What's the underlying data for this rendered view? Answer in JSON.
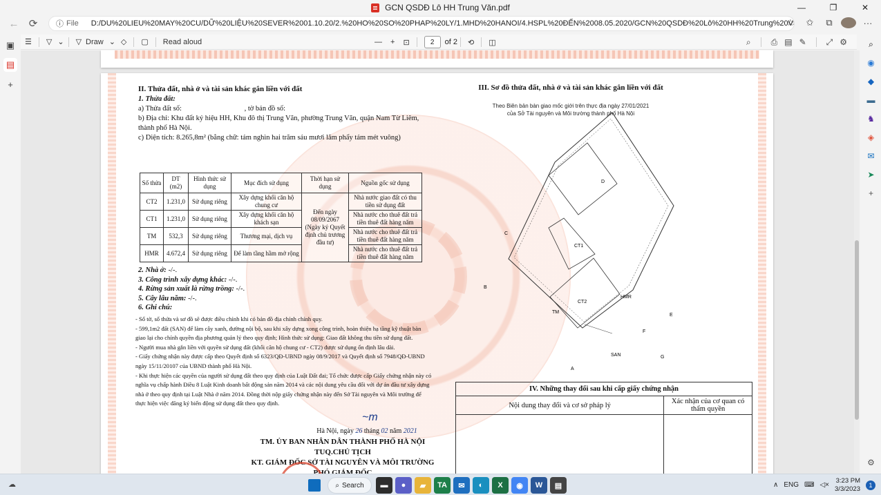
{
  "window": {
    "title": "GCN QSDĐ Lô HH Trung Văn.pdf",
    "minimize": "—",
    "maximize": "❐",
    "close": "✕"
  },
  "addressbar": {
    "back": "←",
    "refresh": "⟳",
    "info_icon": "ⓘ",
    "file_label": "File",
    "url": "D:/DU%20LIEU%20MAY%20CU/DỮ%20LIỆU%20SEVER%2001.10.20/2.%20HO%20SO%20PHAP%20LY/1.MHD%20HANOI/4.HSPL%20ĐẾN%2008.05.2020/GCN%20QSDĐ%20Lô%20HH%20Trung%20Văn.pdf",
    "star": "☆",
    "favorites": "✩",
    "collections": "⧉",
    "more": "···"
  },
  "toolbar": {
    "toc": "☰",
    "highlight": "▽",
    "highlight_caret": "⌄",
    "draw_icon": "▽",
    "draw_label": "Draw",
    "draw_caret": "⌄",
    "erase": "◇",
    "text_box": "▢",
    "read_aloud": "Read aloud",
    "zoom_out": "—",
    "zoom_in": "+",
    "fit": "⊡",
    "page_current": "2",
    "page_total": "of 2",
    "rotate": "⟲",
    "two_page": "◫",
    "search": "⌕",
    "print": "⎙",
    "save": "▤",
    "save_as": "✎",
    "fullscreen": "⤢",
    "settings": "⚙"
  },
  "document": {
    "sec2_title": "II. Thửa đất, nhà ở và tài sản khác gắn liền với đất",
    "land_heading": "1. Thửa đất:",
    "land_a": "a) Thửa đất số:",
    "land_a_map": ", tờ bản đồ số:",
    "land_b": "b) Địa chỉ: Khu đất ký hiệu HH, Khu đô thị Trung Văn, phường Trung Văn, quận Nam Từ Liêm, thành phố Hà Nội.",
    "land_c": "c) Diện tích: 8.265,8m² (bằng chữ: tám nghìn hai trăm sáu mươi lăm phẩy tám mét vuông)",
    "table_headers": [
      "Số thửa",
      "DT (m2)",
      "Hình thức sử dụng",
      "Mục đích sử dụng",
      "Thời hạn sử dụng",
      "Nguồn gốc sử dụng"
    ],
    "table_rows": [
      {
        "so": "CT2",
        "dt": "1.231,0",
        "hinh": "Sử dụng riêng",
        "muc": "Xây dựng khối căn hộ chung cư",
        "nguon": "Nhà nước giao đất có thu tiền sử dụng đất"
      },
      {
        "so": "CT1",
        "dt": "1.231,0",
        "hinh": "Sử dụng riêng",
        "muc": "Xây dựng khối căn hộ khách sạn",
        "nguon": "Nhà nước cho thuê đất trả tiền thuê đất hàng năm"
      },
      {
        "so": "TM",
        "dt": "532,3",
        "hinh": "Sử dụng riêng",
        "muc": "Thương mại, dịch vụ",
        "nguon": "Nhà nước cho thuê đất trả tiền thuê đất hàng năm"
      },
      {
        "so": "HMR",
        "dt": "4.672,4",
        "hinh": "Sử dụng riêng",
        "muc": "Để làm tầng hầm mở rộng",
        "nguon": "Nhà nước cho thuê đất trả tiền thuê đất hàng năm"
      }
    ],
    "thoi_han": "Đến ngày 08/09/2067 (Ngày ký Quyết định chủ trương đầu tư)",
    "item2": "2. Nhà ở:",
    "item2_val": "-/-.",
    "item3": "3. Công trình xây dựng khác:",
    "item3_val": "-/-.",
    "item4": "4. Rừng sản xuất là rừng trồng:",
    "item4_val": "-/-.",
    "item5": "5. Cây lâu năm:",
    "item5_val": "-/-.",
    "item6": "6. Ghi chú:",
    "notes": [
      "- Số tờ, số thửa và sơ đồ sẽ được điều chỉnh khi có bản đồ địa chính chính quy.",
      "- 599,1m2 đất (SAN) để làm cây xanh, đường nội bộ, sau khi xây dựng xong công trình, hoàn thiện hạ tầng kỹ thuật bàn giao lại cho chính quyền địa phương quản lý theo quy định; Hình thức sử dụng: Giao đất không thu tiền sử dụng đất.",
      "- Người mua nhà gắn liền với quyền sử dụng đất (khối căn hộ chung cư - CT2) được sử dụng ổn định lâu dài.",
      "- Giấy chứng nhận này được cấp theo Quyết định số 6323/QĐ-UBND ngày 08/9/2017 và Quyết định số 7948/QĐ-UBND ngày 15/11/20107 của UBND thành phố Hà Nội.",
      "- Khi thực hiện các quyền của người sử dụng đất theo quy định của Luật Đất đai; Tổ chức được cấp Giấy chứng nhận này có nghĩa vụ chấp hành Điều 8 Luật Kinh doanh bất động sản năm 2014 và các nội dung yêu cầu đối với dự án đầu tư xây dựng nhà ở theo quy định tại Luật Nhà ở năm 2014. Đồng thời nộp giấy chứng nhận này đến Sở Tài nguyên và Môi trường để thực hiện việc đăng ký biến động sử dụng đất theo quy định."
    ],
    "date_prefix": "Hà Nội, ngày",
    "date_day": "26",
    "date_month_lbl": "tháng",
    "date_month": "02",
    "date_year_lbl": "năm",
    "date_year": "2021",
    "sign_line1": "TM. ỦY BAN NHÂN DÂN THÀNH PHỐ HÀ NỘI",
    "sign_line2": "TUQ.CHỦ TỊCH",
    "sign_line3": "KT. GIÁM ĐỐC SỞ TÀI NGUYÊN VÀ MÔI TRƯỜNG",
    "sign_line4": "PHÓ GIÁM ĐỐC",
    "sec3_title": "III. Sơ đồ thửa đất, nhà ở và tài sản khác gắn liền với đất",
    "sec3_sub1": "Theo Biên bản bàn giao mốc giới trên thực địa ngày 27/01/2021",
    "sec3_sub2": "của Sở Tài nguyên và Môi trường thành phố Hà Nội",
    "map_labels": {
      "north": "B",
      "a": "A",
      "b": "B",
      "c": "C",
      "d": "D",
      "e": "E",
      "f": "F",
      "g": "G",
      "ct1": "CT1",
      "ct2": "CT2",
      "tm": "TM",
      "hmr": "HMR",
      "san": "SAN"
    },
    "sec4_title": "IV. Những thay đổi sau khi cấp giấy chứng nhận",
    "sec4_col1": "Nội dung thay đổi và cơ sở pháp lý",
    "sec4_col2": "Xác nhận của cơ quan có thẩm quyền"
  },
  "leftbar": {
    "tabs": "▣",
    "pdf_tab": "▤",
    "new_tab": "+"
  },
  "rightbar": {
    "search": "⌕",
    "copilot": "◉",
    "tag": "◆",
    "briefcase": "▬",
    "games": "♞",
    "office": "◈",
    "outlook": "✉",
    "send": "➤",
    "add": "+",
    "settings": "⚙",
    "colors": {
      "search": "#555555",
      "copilot": "#2b7bd6",
      "tag": "#1565c0",
      "briefcase": "#3b6b8f",
      "games": "#5a2ca0",
      "office": "#e0533c",
      "outlook": "#0f6cbd",
      "send": "#1a8a5a",
      "add": "#555555",
      "settings": "#555555"
    }
  },
  "taskbar": {
    "weather": "☁",
    "search_label": "Search",
    "search_icon": "⌕",
    "start_color": "#0f6cbd",
    "apps": [
      {
        "icon": "file-explorer-icon",
        "label": "▬",
        "color": "#2d2d2d"
      },
      {
        "icon": "chat-icon",
        "label": "●",
        "color": "#5b5fc7"
      },
      {
        "icon": "folder-icon",
        "label": "▰",
        "color": "#e8b43a"
      },
      {
        "icon": "dictionary-icon",
        "label": "TA",
        "color": "#1d7f4a"
      },
      {
        "icon": "mail-icon",
        "label": "✉",
        "color": "#1f6fbf"
      },
      {
        "icon": "edge-icon",
        "label": "◐",
        "color": "#1a8fbf"
      },
      {
        "icon": "excel-icon",
        "label": "X",
        "color": "#1d7044"
      },
      {
        "icon": "chrome-icon",
        "label": "◉",
        "color": "#4285f4"
      },
      {
        "icon": "word-icon",
        "label": "W",
        "color": "#2b5797"
      },
      {
        "icon": "terminal-icon",
        "label": "▤",
        "color": "#444444"
      }
    ],
    "tray_chevron": "∧",
    "language": "ENG",
    "network": "⌨",
    "volume": "◁×",
    "time": "3:23 PM",
    "date": "3/3/2023",
    "notifications": "1"
  }
}
